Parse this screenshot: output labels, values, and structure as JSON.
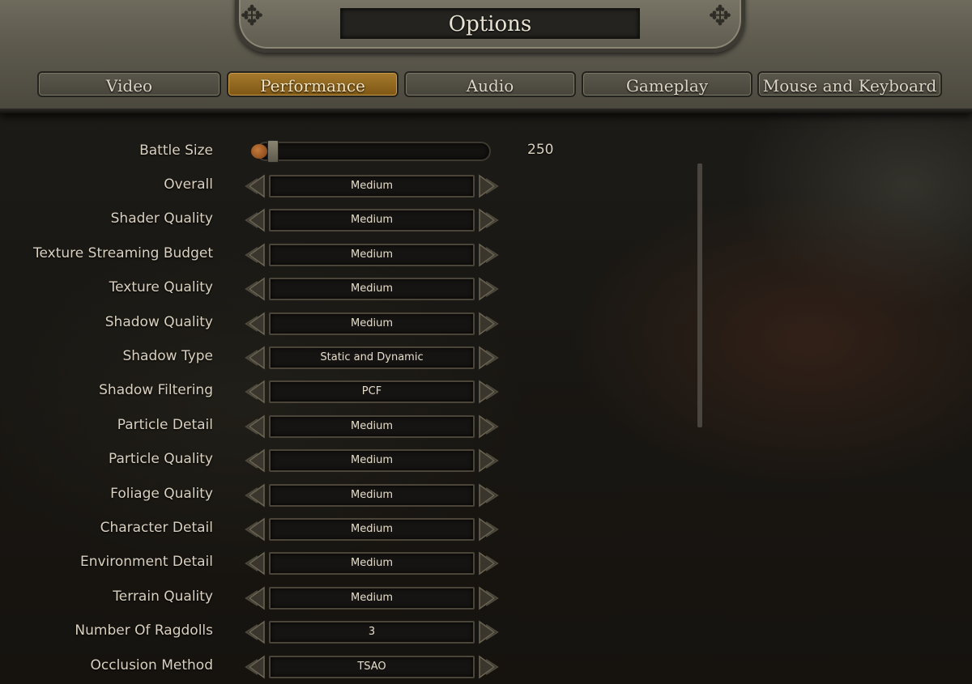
{
  "title": "Options",
  "tabs": [
    {
      "label": "Video",
      "active": false
    },
    {
      "label": "Performance",
      "active": true
    },
    {
      "label": "Audio",
      "active": false
    },
    {
      "label": "Gameplay",
      "active": false
    },
    {
      "label": "Mouse and Keyboard",
      "active": false
    }
  ],
  "battle_size": {
    "label": "Battle Size",
    "value": "250",
    "level": 0.1
  },
  "settings": [
    {
      "label": "Overall",
      "value": "Medium"
    },
    {
      "label": "Shader Quality",
      "value": "Medium"
    },
    {
      "label": "Texture Streaming Budget",
      "value": "Medium"
    },
    {
      "label": "Texture Quality",
      "value": "Medium"
    },
    {
      "label": "Shadow Quality",
      "value": "Medium"
    },
    {
      "label": "Shadow Type",
      "value": "Static and Dynamic"
    },
    {
      "label": "Shadow Filtering",
      "value": "PCF"
    },
    {
      "label": "Particle Detail",
      "value": "Medium"
    },
    {
      "label": "Particle Quality",
      "value": "Medium"
    },
    {
      "label": "Foliage Quality",
      "value": "Medium"
    },
    {
      "label": "Character Detail",
      "value": "Medium"
    },
    {
      "label": "Environment Detail",
      "value": "Medium"
    },
    {
      "label": "Terrain Quality",
      "value": "Medium"
    },
    {
      "label": "Number Of Ragdolls",
      "value": "3"
    },
    {
      "label": "Occlusion Method",
      "value": "TSAO"
    }
  ],
  "colors": {
    "active_tab": "#8f6420",
    "accent": "#c47a3a"
  }
}
